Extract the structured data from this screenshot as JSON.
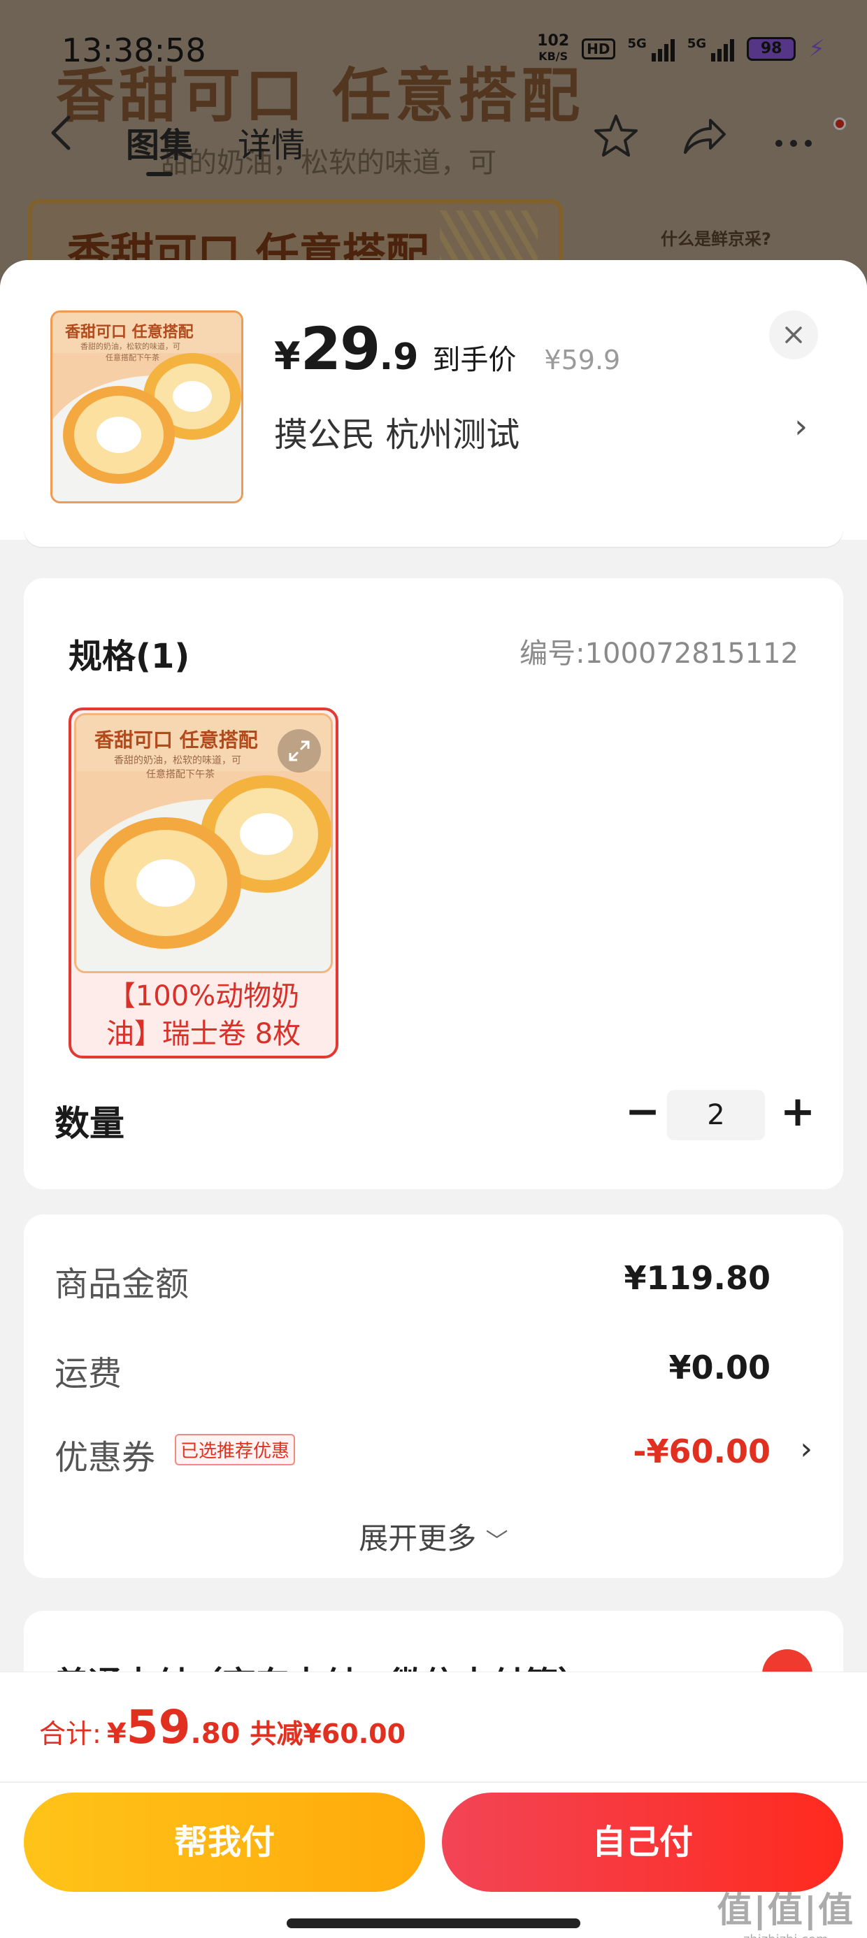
{
  "status_bar": {
    "time": "13:38:58",
    "net_speed_value": "102",
    "net_speed_unit": "KB/S",
    "hd_label": "HD",
    "sim1_label": "5G",
    "sim2_label": "5G",
    "battery": "98"
  },
  "background_page": {
    "banner_text": "香甜可口 任意搭配",
    "banner_sub": "甜的奶油，松软的味道，可",
    "card_text": "香甜可口 任意搭配",
    "side_link": "什么是鲜京采?"
  },
  "nav": {
    "tabs": [
      {
        "label": "图集"
      },
      {
        "label": "详情"
      }
    ]
  },
  "product": {
    "thumb_caption": "香甜可口 任意搭配",
    "thumb_sub": "香甜的奶油，松软的味道，可",
    "thumb_sub2": "任意搭配下午茶",
    "price_currency": "¥",
    "price_integer": "29",
    "price_decimal": ".9",
    "price_tag": "到手价",
    "original_price": "¥59.9",
    "address": "摸公民  杭州测试"
  },
  "spec": {
    "title": "规格(1)",
    "code": "编号:100072815112",
    "option_label": "【100%动物奶油】瑞士卷 8枚"
  },
  "quantity": {
    "label": "数量",
    "value": "2",
    "minus": "−",
    "plus": "+"
  },
  "fees": {
    "rows": [
      {
        "key": "商品金额",
        "value": "¥119.80"
      },
      {
        "key": "运费",
        "value": "¥0.00"
      },
      {
        "key": "优惠券",
        "tag": "已选推荐优惠",
        "value": "-¥60.00"
      }
    ],
    "expand_label": "展开更多"
  },
  "payment": {
    "method_label": "普通支付（京东支付、微信支付等）"
  },
  "footer": {
    "total_label": "合计:",
    "total_currency": "¥",
    "total_integer": "59",
    "total_decimal": ".80",
    "total_saving": "共减¥60.00",
    "help_pay_label": "帮我付",
    "self_pay_label": "自己付"
  },
  "watermark": {
    "big": "值|值|值",
    "small": "zhizhizhi.com"
  },
  "colors": {
    "accent_red": "#e23020",
    "help_button": "#ffb812",
    "self_button": "#f7342d",
    "thumb_border": "#f19a52"
  }
}
